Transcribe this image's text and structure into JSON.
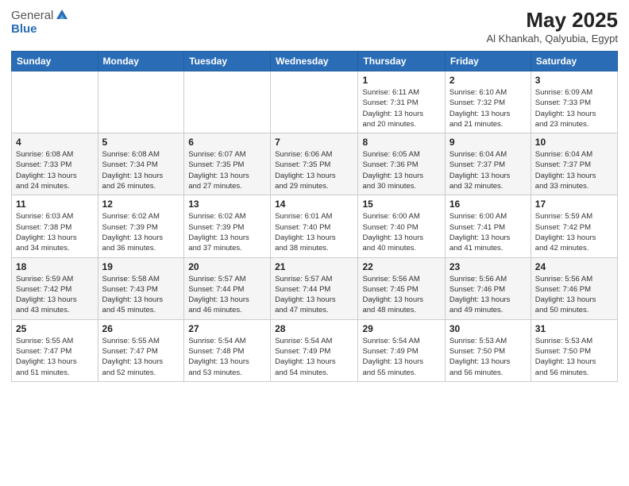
{
  "header": {
    "logo_general": "General",
    "logo_blue": "Blue",
    "title": "May 2025",
    "subtitle": "Al Khankah, Qalyubia, Egypt"
  },
  "days_of_week": [
    "Sunday",
    "Monday",
    "Tuesday",
    "Wednesday",
    "Thursday",
    "Friday",
    "Saturday"
  ],
  "weeks": [
    [
      {
        "day": "",
        "info": ""
      },
      {
        "day": "",
        "info": ""
      },
      {
        "day": "",
        "info": ""
      },
      {
        "day": "",
        "info": ""
      },
      {
        "day": "1",
        "info": "Sunrise: 6:11 AM\nSunset: 7:31 PM\nDaylight: 13 hours\nand 20 minutes."
      },
      {
        "day": "2",
        "info": "Sunrise: 6:10 AM\nSunset: 7:32 PM\nDaylight: 13 hours\nand 21 minutes."
      },
      {
        "day": "3",
        "info": "Sunrise: 6:09 AM\nSunset: 7:33 PM\nDaylight: 13 hours\nand 23 minutes."
      }
    ],
    [
      {
        "day": "4",
        "info": "Sunrise: 6:08 AM\nSunset: 7:33 PM\nDaylight: 13 hours\nand 24 minutes."
      },
      {
        "day": "5",
        "info": "Sunrise: 6:08 AM\nSunset: 7:34 PM\nDaylight: 13 hours\nand 26 minutes."
      },
      {
        "day": "6",
        "info": "Sunrise: 6:07 AM\nSunset: 7:35 PM\nDaylight: 13 hours\nand 27 minutes."
      },
      {
        "day": "7",
        "info": "Sunrise: 6:06 AM\nSunset: 7:35 PM\nDaylight: 13 hours\nand 29 minutes."
      },
      {
        "day": "8",
        "info": "Sunrise: 6:05 AM\nSunset: 7:36 PM\nDaylight: 13 hours\nand 30 minutes."
      },
      {
        "day": "9",
        "info": "Sunrise: 6:04 AM\nSunset: 7:37 PM\nDaylight: 13 hours\nand 32 minutes."
      },
      {
        "day": "10",
        "info": "Sunrise: 6:04 AM\nSunset: 7:37 PM\nDaylight: 13 hours\nand 33 minutes."
      }
    ],
    [
      {
        "day": "11",
        "info": "Sunrise: 6:03 AM\nSunset: 7:38 PM\nDaylight: 13 hours\nand 34 minutes."
      },
      {
        "day": "12",
        "info": "Sunrise: 6:02 AM\nSunset: 7:39 PM\nDaylight: 13 hours\nand 36 minutes."
      },
      {
        "day": "13",
        "info": "Sunrise: 6:02 AM\nSunset: 7:39 PM\nDaylight: 13 hours\nand 37 minutes."
      },
      {
        "day": "14",
        "info": "Sunrise: 6:01 AM\nSunset: 7:40 PM\nDaylight: 13 hours\nand 38 minutes."
      },
      {
        "day": "15",
        "info": "Sunrise: 6:00 AM\nSunset: 7:40 PM\nDaylight: 13 hours\nand 40 minutes."
      },
      {
        "day": "16",
        "info": "Sunrise: 6:00 AM\nSunset: 7:41 PM\nDaylight: 13 hours\nand 41 minutes."
      },
      {
        "day": "17",
        "info": "Sunrise: 5:59 AM\nSunset: 7:42 PM\nDaylight: 13 hours\nand 42 minutes."
      }
    ],
    [
      {
        "day": "18",
        "info": "Sunrise: 5:59 AM\nSunset: 7:42 PM\nDaylight: 13 hours\nand 43 minutes."
      },
      {
        "day": "19",
        "info": "Sunrise: 5:58 AM\nSunset: 7:43 PM\nDaylight: 13 hours\nand 45 minutes."
      },
      {
        "day": "20",
        "info": "Sunrise: 5:57 AM\nSunset: 7:44 PM\nDaylight: 13 hours\nand 46 minutes."
      },
      {
        "day": "21",
        "info": "Sunrise: 5:57 AM\nSunset: 7:44 PM\nDaylight: 13 hours\nand 47 minutes."
      },
      {
        "day": "22",
        "info": "Sunrise: 5:56 AM\nSunset: 7:45 PM\nDaylight: 13 hours\nand 48 minutes."
      },
      {
        "day": "23",
        "info": "Sunrise: 5:56 AM\nSunset: 7:46 PM\nDaylight: 13 hours\nand 49 minutes."
      },
      {
        "day": "24",
        "info": "Sunrise: 5:56 AM\nSunset: 7:46 PM\nDaylight: 13 hours\nand 50 minutes."
      }
    ],
    [
      {
        "day": "25",
        "info": "Sunrise: 5:55 AM\nSunset: 7:47 PM\nDaylight: 13 hours\nand 51 minutes."
      },
      {
        "day": "26",
        "info": "Sunrise: 5:55 AM\nSunset: 7:47 PM\nDaylight: 13 hours\nand 52 minutes."
      },
      {
        "day": "27",
        "info": "Sunrise: 5:54 AM\nSunset: 7:48 PM\nDaylight: 13 hours\nand 53 minutes."
      },
      {
        "day": "28",
        "info": "Sunrise: 5:54 AM\nSunset: 7:49 PM\nDaylight: 13 hours\nand 54 minutes."
      },
      {
        "day": "29",
        "info": "Sunrise: 5:54 AM\nSunset: 7:49 PM\nDaylight: 13 hours\nand 55 minutes."
      },
      {
        "day": "30",
        "info": "Sunrise: 5:53 AM\nSunset: 7:50 PM\nDaylight: 13 hours\nand 56 minutes."
      },
      {
        "day": "31",
        "info": "Sunrise: 5:53 AM\nSunset: 7:50 PM\nDaylight: 13 hours\nand 56 minutes."
      }
    ]
  ]
}
